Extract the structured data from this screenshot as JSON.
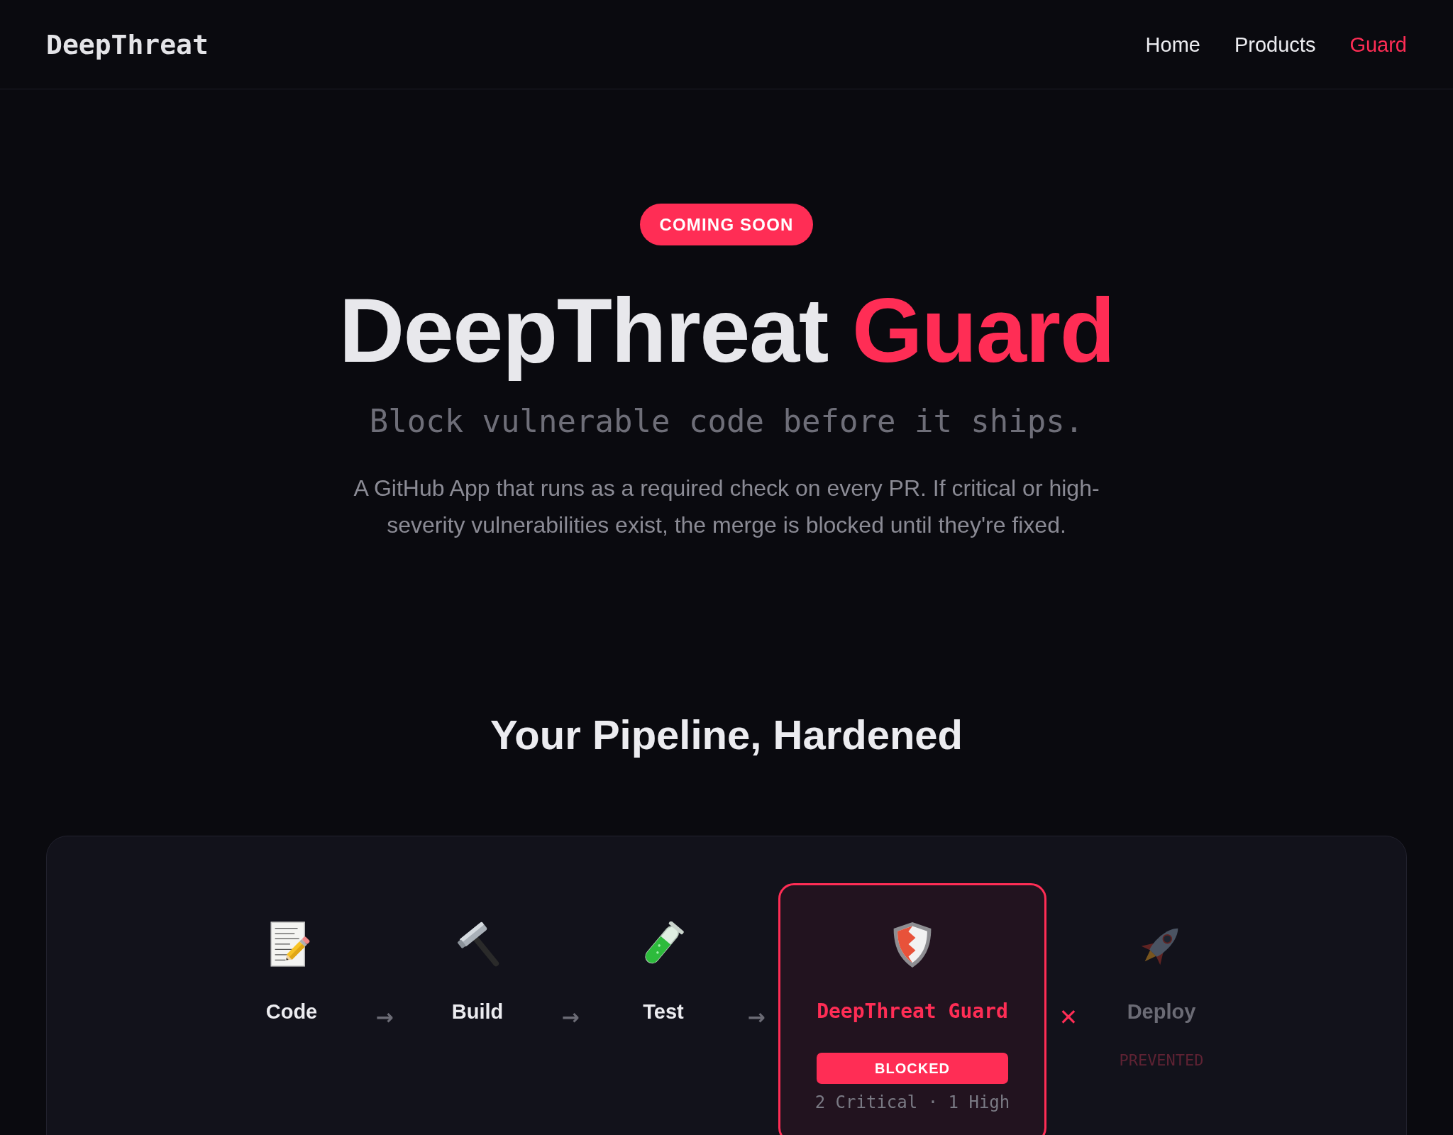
{
  "nav": {
    "logo": "DeepThreat",
    "items": [
      {
        "label": "Home",
        "selected": false
      },
      {
        "label": "Products",
        "selected": false
      },
      {
        "label": "Guard",
        "selected": true
      }
    ]
  },
  "hero": {
    "badge": "COMING SOON",
    "title_parts": [
      {
        "text": "DeepThreat",
        "accent": false
      },
      {
        "text": "Guard",
        "accent": true
      }
    ],
    "tagline": "Block vulnerable code before it ships.",
    "description": "A GitHub App that runs as a required check on every PR. If critical or high-severity vulnerabilities exist, the merge is blocked until they're fixed."
  },
  "pipeline": {
    "heading": "Your Pipeline, Hardened",
    "steps": [
      {
        "kind": "stage",
        "label": "Code",
        "disabled": false
      },
      {
        "kind": "stage",
        "label": "Build",
        "disabled": false,
        "link": {
          "symbol": "→",
          "blocked": false
        }
      },
      {
        "kind": "stage",
        "label": "Test",
        "disabled": false,
        "link": {
          "symbol": "→",
          "blocked": false
        }
      },
      {
        "kind": "guard",
        "label": "DeepThreat Guard",
        "disabled": false,
        "link": {
          "symbol": "→",
          "blocked": false
        },
        "badge": "BLOCKED",
        "summary": "2 Critical · 1 High"
      },
      {
        "kind": "stage",
        "label": "Deploy",
        "disabled": true,
        "link": {
          "symbol": "✕",
          "blocked": true
        },
        "status": "PREVENTED"
      }
    ]
  }
}
